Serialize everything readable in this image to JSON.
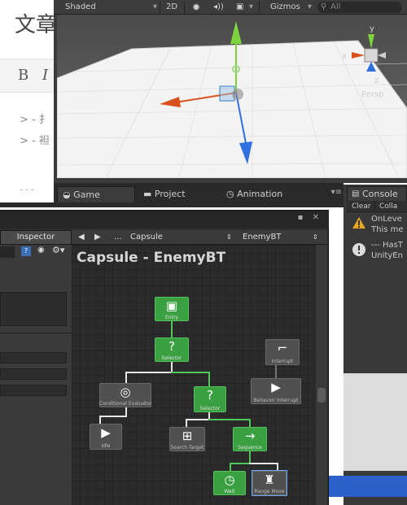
{
  "blog": {
    "title": "文章",
    "bold_button": "B",
    "italic_button": "I",
    "line1": "> - 扌",
    "line2": "> - 袒",
    "rule": "---"
  },
  "scene": {
    "shading_mode": "Shaded",
    "mode_2d": "2D",
    "gizmos_label": "Gizmos",
    "search_placeholder": "All",
    "gizmo_labels": {
      "x": "x",
      "y": "y",
      "z": "z",
      "persp": "Persp"
    },
    "axis_colors": {
      "x": "#d9521e",
      "y": "#7ed33c",
      "z": "#2f6fe0"
    }
  },
  "tabs": {
    "game": "Game",
    "project": "Project",
    "animation": "Animation"
  },
  "console": {
    "tab": "Console",
    "clear": "Clear",
    "collapse": "Colla",
    "messages": [
      {
        "icon": "warning-icon",
        "line1": "OnLeve",
        "line2": "This me"
      },
      {
        "icon": "info-icon",
        "line1": "--- HasT",
        "line2": "UnityEn"
      }
    ]
  },
  "behavior_designer": {
    "inspector_tab": "Inspector",
    "object_name": "Capsule",
    "tree_name": "EnemyBT",
    "graph_title": "Capsule - EnemyBT",
    "ellipsis": "...",
    "nodes": [
      {
        "id": "entry",
        "label": "Entry",
        "glyph": "▣",
        "style": "green"
      },
      {
        "id": "selector-root",
        "label": "Selector",
        "glyph": "?",
        "style": "green"
      },
      {
        "id": "conditional-evaluator",
        "label": "Conditional Evaluator",
        "glyph": "◎",
        "style": "gray"
      },
      {
        "id": "selector-child",
        "label": "Selector",
        "glyph": "?",
        "style": "green"
      },
      {
        "id": "behavior-interrupt",
        "label": "Behavior Interrupt",
        "glyph": "▶",
        "style": "gray"
      },
      {
        "id": "interrupt",
        "label": "Interrupt",
        "glyph": "⌐",
        "style": "gray"
      },
      {
        "id": "idle",
        "label": "Idle",
        "glyph": "▶",
        "style": "gray"
      },
      {
        "id": "search-target",
        "label": "Search Target",
        "glyph": "⊞",
        "style": "gray"
      },
      {
        "id": "sequence",
        "label": "Sequence",
        "glyph": "→",
        "style": "green"
      },
      {
        "id": "wait",
        "label": "Wait",
        "glyph": "◷",
        "style": "green"
      },
      {
        "id": "range-move",
        "label": "Range Move",
        "glyph": "♜",
        "style": "gray"
      }
    ]
  }
}
